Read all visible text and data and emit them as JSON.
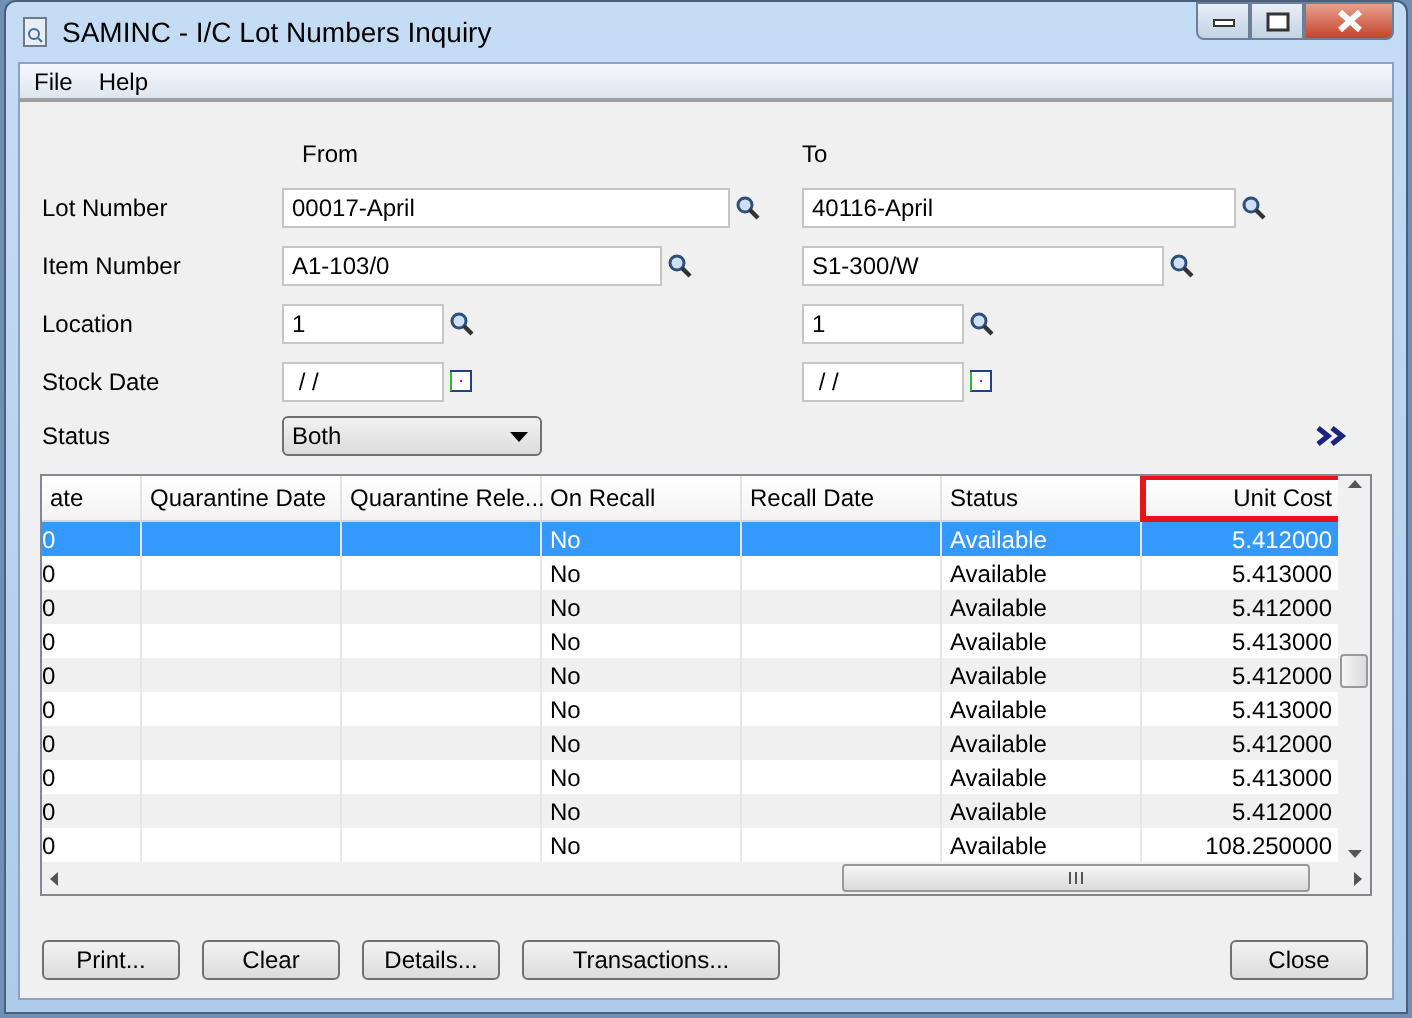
{
  "window": {
    "title": "SAMINC - I/C Lot Numbers Inquiry"
  },
  "menu": [
    {
      "label": "File"
    },
    {
      "label": "Help"
    }
  ],
  "form": {
    "from_label": "From",
    "to_label": "To",
    "rows": [
      {
        "label": "Lot Number",
        "kind": "lookup",
        "from": "00017-April",
        "to": "40116-April"
      },
      {
        "label": "Item Number",
        "kind": "lookup",
        "from": "A1-103/0",
        "to": "S1-300/W"
      },
      {
        "label": "Location",
        "kind": "lookup",
        "from": "1",
        "to": "1"
      },
      {
        "label": "Stock Date",
        "kind": "date",
        "from": " / /",
        "to": " / /"
      }
    ],
    "status": {
      "label": "Status",
      "value": "Both"
    }
  },
  "grid": {
    "columns": [
      {
        "label": "ate",
        "kind": "text",
        "highlighted": false
      },
      {
        "label": "Quarantine Date",
        "kind": "text",
        "highlighted": false
      },
      {
        "label": "Quarantine Rele...",
        "kind": "text",
        "highlighted": false
      },
      {
        "label": "On Recall",
        "kind": "text",
        "highlighted": false
      },
      {
        "label": "Recall Date",
        "kind": "text",
        "highlighted": false
      },
      {
        "label": "Status",
        "kind": "text",
        "highlighted": false
      },
      {
        "label": "Unit Cost",
        "kind": "number",
        "highlighted": true
      }
    ],
    "rows": [
      {
        "selected": true,
        "cells": [
          "0",
          "",
          "",
          "No",
          "",
          "Available",
          "5.412000"
        ]
      },
      {
        "selected": false,
        "cells": [
          "0",
          "",
          "",
          "No",
          "",
          "Available",
          "5.413000"
        ]
      },
      {
        "selected": false,
        "cells": [
          "0",
          "",
          "",
          "No",
          "",
          "Available",
          "5.412000"
        ]
      },
      {
        "selected": false,
        "cells": [
          "0",
          "",
          "",
          "No",
          "",
          "Available",
          "5.413000"
        ]
      },
      {
        "selected": false,
        "cells": [
          "0",
          "",
          "",
          "No",
          "",
          "Available",
          "5.412000"
        ]
      },
      {
        "selected": false,
        "cells": [
          "0",
          "",
          "",
          "No",
          "",
          "Available",
          "5.413000"
        ]
      },
      {
        "selected": false,
        "cells": [
          "0",
          "",
          "",
          "No",
          "",
          "Available",
          "5.412000"
        ]
      },
      {
        "selected": false,
        "cells": [
          "0",
          "",
          "",
          "No",
          "",
          "Available",
          "5.413000"
        ]
      },
      {
        "selected": false,
        "cells": [
          "0",
          "",
          "",
          "No",
          "",
          "Available",
          "5.412000"
        ]
      },
      {
        "selected": false,
        "cells": [
          "0",
          "",
          "",
          "No",
          "",
          "Available",
          "108.250000"
        ]
      }
    ]
  },
  "buttons": [
    {
      "label": "Print..."
    },
    {
      "label": "Clear"
    },
    {
      "label": "Details..."
    },
    {
      "label": "Transactions..."
    }
  ],
  "close_button": {
    "label": "Close"
  }
}
